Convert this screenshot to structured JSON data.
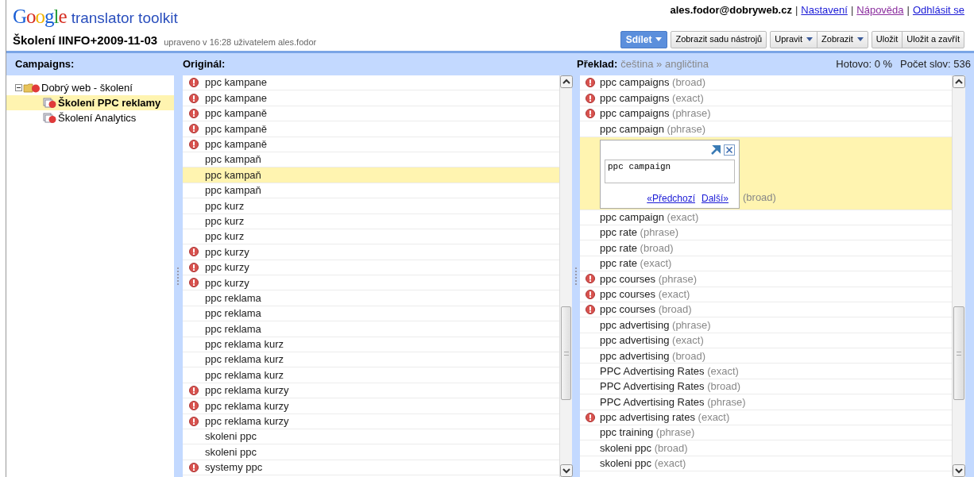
{
  "header": {
    "logo_word": "Google",
    "product": "translator toolkit",
    "document_title": "Školení IINFO+2009-11-03",
    "edited_note": "upraveno v 16:28 uživatelem ales.fodor",
    "user": "ales.fodor@dobryweb.cz",
    "links": [
      {
        "separator": "|",
        "label": "Nastavení",
        "visited": false
      },
      {
        "separator": "|",
        "label": "Nápověda",
        "visited": true
      },
      {
        "separator": "|",
        "label": "Odhlásit se",
        "visited": false
      }
    ],
    "button_groups": [
      [
        {
          "label": "Sdílet",
          "kind": "primary",
          "dropdown": true
        }
      ],
      [
        {
          "label": "Zobrazit sadu nástrojů",
          "kind": "plain",
          "dropdown": false
        }
      ],
      [
        {
          "label": "Upravit",
          "kind": "plain",
          "dropdown": true
        },
        {
          "label": "Zobrazit",
          "kind": "plain",
          "dropdown": true
        }
      ],
      [
        {
          "label": "Uložit",
          "kind": "plain",
          "dropdown": false
        },
        {
          "label": "Uložit a zavřít",
          "kind": "plain",
          "dropdown": false
        }
      ]
    ]
  },
  "campaigns": {
    "heading": "Campaigns:",
    "tree": [
      {
        "label": "Dobrý web - školení",
        "expanded": true,
        "children": [
          {
            "label": "Školení PPC reklamy",
            "selected": true
          },
          {
            "label": "Školení Analytics",
            "selected": false
          }
        ]
      }
    ]
  },
  "original": {
    "heading": "Originál:",
    "rows": [
      {
        "text": "ppc kampane",
        "error": true,
        "selected": false
      },
      {
        "text": "ppc kampane",
        "error": true,
        "selected": false
      },
      {
        "text": "ppc kampaně",
        "error": true,
        "selected": false
      },
      {
        "text": "ppc kampaně",
        "error": true,
        "selected": false
      },
      {
        "text": "ppc kampaně",
        "error": true,
        "selected": false
      },
      {
        "text": "ppc kampaň",
        "error": false,
        "selected": false
      },
      {
        "text": "ppc kampaň",
        "error": false,
        "selected": true
      },
      {
        "text": "ppc kampaň",
        "error": false,
        "selected": false
      },
      {
        "text": "ppc kurz",
        "error": false,
        "selected": false
      },
      {
        "text": "ppc kurz",
        "error": false,
        "selected": false
      },
      {
        "text": "ppc kurz",
        "error": false,
        "selected": false
      },
      {
        "text": "ppc kurzy",
        "error": true,
        "selected": false
      },
      {
        "text": "ppc kurzy",
        "error": true,
        "selected": false
      },
      {
        "text": "ppc kurzy",
        "error": true,
        "selected": false
      },
      {
        "text": "ppc reklama",
        "error": false,
        "selected": false
      },
      {
        "text": "ppc reklama",
        "error": false,
        "selected": false
      },
      {
        "text": "ppc reklama",
        "error": false,
        "selected": false
      },
      {
        "text": "ppc reklama kurz",
        "error": false,
        "selected": false
      },
      {
        "text": "ppc reklama kurz",
        "error": false,
        "selected": false
      },
      {
        "text": "ppc reklama kurz",
        "error": false,
        "selected": false
      },
      {
        "text": "ppc reklama kurzy",
        "error": true,
        "selected": false
      },
      {
        "text": "ppc reklama kurzy",
        "error": true,
        "selected": false
      },
      {
        "text": "ppc reklama kurzy",
        "error": true,
        "selected": false
      },
      {
        "text": "skoleni ppc",
        "error": false,
        "selected": false
      },
      {
        "text": "skoleni ppc",
        "error": false,
        "selected": false
      },
      {
        "text": "systemy ppc",
        "error": true,
        "selected": false
      }
    ]
  },
  "translation": {
    "heading": "Překlad:",
    "languages": "čeština » angličtina",
    "progress": "Hotovo: 0 %",
    "word_count": "Počet slov: 536",
    "rows": [
      {
        "kind": "segment",
        "text": "ppc campaigns",
        "match": "(broad)",
        "error": true
      },
      {
        "kind": "segment",
        "text": "ppc campaigns",
        "match": "(exact)",
        "error": true
      },
      {
        "kind": "segment",
        "text": "ppc campaigns",
        "match": "(phrase)",
        "error": true
      },
      {
        "kind": "segment",
        "text": "ppc campaign",
        "match": "(phrase)",
        "error": false
      },
      {
        "kind": "editor",
        "value": "ppc campaign",
        "previous": "«Předchozí",
        "next": "Další»",
        "match": "(broad)"
      },
      {
        "kind": "segment",
        "text": "ppc campaign",
        "match": "(exact)",
        "error": false
      },
      {
        "kind": "segment",
        "text": "ppc rate",
        "match": "(phrase)",
        "error": false
      },
      {
        "kind": "segment",
        "text": "ppc rate",
        "match": "(broad)",
        "error": false
      },
      {
        "kind": "segment",
        "text": "ppc rate",
        "match": "(exact)",
        "error": false
      },
      {
        "kind": "segment",
        "text": "ppc courses",
        "match": "(phrase)",
        "error": true
      },
      {
        "kind": "segment",
        "text": "ppc courses",
        "match": "(exact)",
        "error": true
      },
      {
        "kind": "segment",
        "text": "ppc courses",
        "match": "(broad)",
        "error": true
      },
      {
        "kind": "segment",
        "text": "ppc advertising",
        "match": "(phrase)",
        "error": false
      },
      {
        "kind": "segment",
        "text": "ppc advertising",
        "match": "(exact)",
        "error": false
      },
      {
        "kind": "segment",
        "text": "ppc advertising",
        "match": "(broad)",
        "error": false
      },
      {
        "kind": "segment",
        "text": "PPC Advertising Rates",
        "match": "(exact)",
        "error": false
      },
      {
        "kind": "segment",
        "text": "PPC Advertising Rates",
        "match": "(broad)",
        "error": false
      },
      {
        "kind": "segment",
        "text": "PPC Advertising Rates",
        "match": "(phrase)",
        "error": false
      },
      {
        "kind": "segment",
        "text": "ppc advertising rates",
        "match": "(exact)",
        "error": true
      },
      {
        "kind": "segment",
        "text": "ppc training",
        "match": "(phrase)",
        "error": false
      },
      {
        "kind": "segment",
        "text": "skoleni ppc",
        "match": "(broad)",
        "error": false
      },
      {
        "kind": "segment",
        "text": "skoleni ppc",
        "match": "(exact)",
        "error": false
      }
    ]
  }
}
